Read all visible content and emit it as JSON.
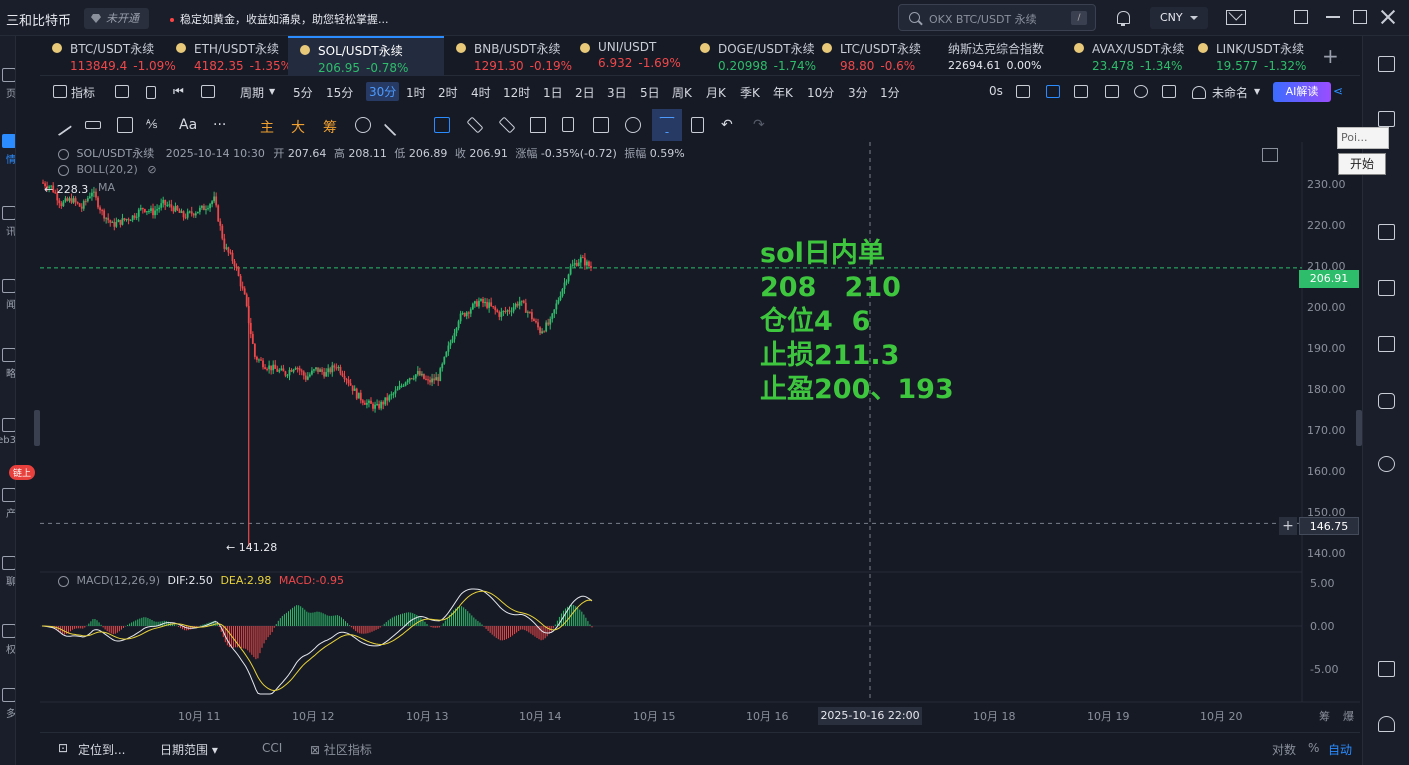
{
  "titlebar": {
    "app_title": "三和比特币",
    "badge": "未开通",
    "ticker": "稳定如黄金，收益如涌泉，助您轻松掌握...",
    "search_placeholder": "OKX BTC/USDT 永续",
    "search_key": "/",
    "currency": "CNY"
  },
  "leftbar": {
    "items": [
      "页",
      "情",
      "讯",
      "闻",
      "略",
      "eb3",
      "产",
      "聊",
      "权",
      "多"
    ],
    "active_index": 1,
    "chain_badge": "链上"
  },
  "tabs": [
    {
      "name": "BTC/USDT永续",
      "price": "113849.4",
      "change": "-1.09%",
      "dir": "down"
    },
    {
      "name": "ETH/USDT永续",
      "price": "4182.35",
      "change": "-1.35%",
      "dir": "down"
    },
    {
      "name": "SOL/USDT永续",
      "price": "206.95",
      "change": "-0.78%",
      "dir": "up",
      "active": true
    },
    {
      "name": "BNB/USDT永续",
      "price": "1291.30",
      "change": "-0.19%",
      "dir": "down"
    },
    {
      "name": "UNI/USDT",
      "price": "6.932",
      "change": "-1.69%",
      "dir": "down"
    },
    {
      "name": "DOGE/USDT永续",
      "price": "0.20998",
      "change": "-1.74%",
      "dir": "up"
    },
    {
      "name": "LTC/USDT永续",
      "price": "98.80",
      "change": "-0.6%",
      "dir": "down"
    },
    {
      "name": "纳斯达克综合指数",
      "price": "22694.61",
      "change": "0.00%",
      "dir": "flat"
    },
    {
      "name": "AVAX/USDT永续",
      "price": "23.478",
      "change": "-1.34%",
      "dir": "up"
    },
    {
      "name": "LINK/USDT永续",
      "price": "19.577",
      "change": "-1.32%",
      "dir": "up"
    }
  ],
  "ptool": {
    "indicator": "指标",
    "period": "周期",
    "periods": [
      "5分",
      "15分",
      "30分",
      "1时",
      "2时",
      "4时",
      "12时",
      "1日",
      "2日",
      "3日",
      "5日",
      "周K",
      "月K",
      "季K",
      "年K",
      "10分",
      "3分",
      "1分"
    ],
    "selected_period": "30分",
    "countdown": "0s",
    "layout_name": "未命名",
    "ai_button": "AI解读"
  },
  "dtool": {
    "text_tool": "Aa",
    "main": "主",
    "big": "大",
    "chips": "筹"
  },
  "chart": {
    "info": {
      "symbol": "SOL/USDT永续",
      "datetime": "2025-10-14 10:30",
      "open_label": "开",
      "open": "207.64",
      "high_label": "高",
      "high": "208.11",
      "low_label": "低",
      "low": "206.89",
      "close_label": "收",
      "close": "206.91",
      "change_label": "涨幅",
      "change": "-0.35%(-0.72)",
      "amp_label": "振幅",
      "amp": "0.59%"
    },
    "boll": "BOLL(20,2)",
    "ma": "MA",
    "macd_label": "MACD(12,26,9)",
    "dif": "DIF:2.50",
    "dea": "DEA:2.98",
    "macd_val": "MACD:-0.95",
    "last_price": "206.91",
    "cross_price": "146.75",
    "cross_date": "2025-10-16 22:00",
    "high_marker": "← 228.3",
    "low_marker": "← 141.28",
    "x_labels": [
      "10月 11",
      "10月 12",
      "10月 13",
      "10月 14",
      "10月 15",
      "10月 16",
      "10月 18",
      "10月 19",
      "10月 20"
    ],
    "y_labels": [
      "230.00",
      "220.00",
      "210.00",
      "200.00",
      "190.00",
      "180.00",
      "170.00",
      "160.00",
      "150.00",
      "140.00"
    ],
    "macd_y_labels": [
      "5.00",
      "0.00",
      "-5.00"
    ],
    "axis_corner": [
      "筹",
      "爆"
    ],
    "note": [
      "sol日内单",
      "208   210",
      "仓位4  6",
      "止损211.3",
      "止盈200、193"
    ],
    "colors": {
      "up": "#2ebd6b",
      "down": "#f0484a",
      "note": "#3ec63e",
      "last_price_bg": "#2ebd6b"
    }
  },
  "chart_data": {
    "type": "candlestick",
    "symbol": "SOL/USDT永续",
    "interval": "30分",
    "ylim": [
      136,
      233
    ],
    "close_path": [
      [
        0,
        227
      ],
      [
        1,
        226
      ],
      [
        2,
        222
      ],
      [
        3,
        223
      ],
      [
        4,
        221
      ],
      [
        5,
        225
      ],
      [
        6,
        220
      ],
      [
        7,
        217
      ],
      [
        8,
        218
      ],
      [
        9,
        219
      ],
      [
        10,
        221
      ],
      [
        11,
        220
      ],
      [
        12,
        222
      ],
      [
        13,
        221
      ],
      [
        14,
        219
      ],
      [
        15,
        220
      ],
      [
        16,
        221
      ],
      [
        17,
        223
      ],
      [
        18,
        212
      ],
      [
        19,
        208
      ],
      [
        20,
        200
      ],
      [
        21,
        186
      ],
      [
        22,
        184
      ],
      [
        23,
        183
      ],
      [
        24,
        182
      ],
      [
        25,
        184
      ],
      [
        26,
        181
      ],
      [
        27,
        183
      ],
      [
        28,
        182
      ],
      [
        29,
        184
      ],
      [
        30,
        181
      ],
      [
        31,
        177
      ],
      [
        32,
        175
      ],
      [
        33,
        174
      ],
      [
        34,
        176
      ],
      [
        35,
        178
      ],
      [
        36,
        181
      ],
      [
        37,
        182
      ],
      [
        38,
        180
      ],
      [
        39,
        181
      ],
      [
        40,
        188
      ],
      [
        41,
        195
      ],
      [
        42,
        197
      ],
      [
        43,
        199
      ],
      [
        44,
        198
      ],
      [
        45,
        196
      ],
      [
        46,
        197
      ],
      [
        47,
        199
      ],
      [
        48,
        196
      ],
      [
        49,
        192
      ],
      [
        50,
        194
      ],
      [
        51,
        201
      ],
      [
        52,
        207
      ],
      [
        53,
        209
      ],
      [
        54,
        207
      ]
    ],
    "extremes": {
      "high": 228.3,
      "low": 141.28
    }
  }
}
